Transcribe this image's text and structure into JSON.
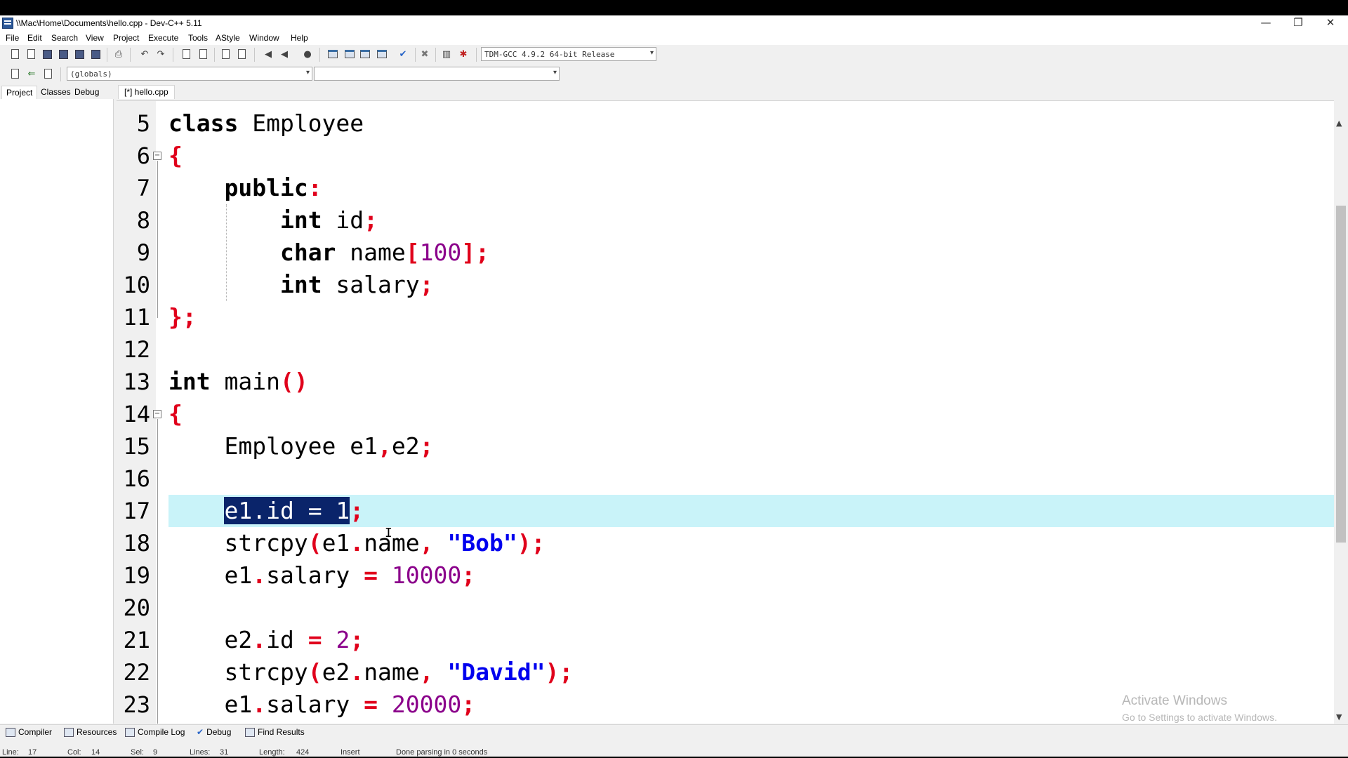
{
  "window": {
    "title": "\\\\Mac\\Home\\Documents\\hello.cpp - Dev-C++ 5.11",
    "minimize": "—",
    "restore": "❐",
    "close": "✕"
  },
  "menu": [
    "File",
    "Edit",
    "Search",
    "View",
    "Project",
    "Execute",
    "Tools",
    "AStyle",
    "Window",
    "Help"
  ],
  "toolbar": {
    "compiler_select": "TDM-GCC 4.9.2 64-bit Release",
    "scope_select": "(globals)",
    "member_select": ""
  },
  "left_tabs": [
    "Project",
    "Classes",
    "Debug"
  ],
  "file_tab": "[*] hello.cpp",
  "editor": {
    "current_line": 17,
    "lines": [
      {
        "num": "5",
        "tokens": [
          [
            "kw",
            "class"
          ],
          [
            "t",
            " Employee"
          ]
        ]
      },
      {
        "num": "6",
        "tokens": [
          [
            "p",
            "{"
          ]
        ]
      },
      {
        "num": "7",
        "tokens": [
          [
            "t",
            "    "
          ],
          [
            "kw",
            "public"
          ],
          [
            "p",
            ":"
          ]
        ]
      },
      {
        "num": "8",
        "tokens": [
          [
            "t",
            "        "
          ],
          [
            "kw",
            "int"
          ],
          [
            "t",
            " id"
          ],
          [
            "p",
            ";"
          ]
        ]
      },
      {
        "num": "9",
        "tokens": [
          [
            "t",
            "        "
          ],
          [
            "kw",
            "char"
          ],
          [
            "t",
            " name"
          ],
          [
            "p",
            "["
          ],
          [
            "n",
            "100"
          ],
          [
            "p",
            "];"
          ]
        ]
      },
      {
        "num": "10",
        "tokens": [
          [
            "t",
            "        "
          ],
          [
            "kw",
            "int"
          ],
          [
            "t",
            " salary"
          ],
          [
            "p",
            ";"
          ]
        ]
      },
      {
        "num": "11",
        "tokens": [
          [
            "p",
            "};"
          ]
        ]
      },
      {
        "num": "12",
        "tokens": []
      },
      {
        "num": "13",
        "tokens": [
          [
            "kw",
            "int"
          ],
          [
            "t",
            " main"
          ],
          [
            "p",
            "()"
          ]
        ]
      },
      {
        "num": "14",
        "tokens": [
          [
            "p",
            "{"
          ]
        ]
      },
      {
        "num": "15",
        "tokens": [
          [
            "t",
            "    Employee e1"
          ],
          [
            "p",
            ","
          ],
          [
            "t",
            "e2"
          ],
          [
            "p",
            ";"
          ]
        ]
      },
      {
        "num": "16",
        "tokens": []
      },
      {
        "num": "17",
        "tokens": [
          [
            "t",
            "    "
          ],
          [
            "sel",
            "e1.id = 1"
          ],
          [
            "p",
            ";"
          ]
        ]
      },
      {
        "num": "18",
        "tokens": [
          [
            "t",
            "    strcpy"
          ],
          [
            "p",
            "("
          ],
          [
            "t",
            "e1"
          ],
          [
            "p",
            "."
          ],
          [
            "t",
            "name"
          ],
          [
            "p",
            ","
          ],
          [
            "t",
            " "
          ],
          [
            "s",
            "\"Bob\""
          ],
          [
            "p",
            ");"
          ]
        ]
      },
      {
        "num": "19",
        "tokens": [
          [
            "t",
            "    e1"
          ],
          [
            "p",
            "."
          ],
          [
            "t",
            "salary "
          ],
          [
            "p",
            "="
          ],
          [
            "t",
            " "
          ],
          [
            "n",
            "10000"
          ],
          [
            "p",
            ";"
          ]
        ]
      },
      {
        "num": "20",
        "tokens": []
      },
      {
        "num": "21",
        "tokens": [
          [
            "t",
            "    e2"
          ],
          [
            "p",
            "."
          ],
          [
            "t",
            "id "
          ],
          [
            "p",
            "="
          ],
          [
            "t",
            " "
          ],
          [
            "n",
            "2"
          ],
          [
            "p",
            ";"
          ]
        ]
      },
      {
        "num": "22",
        "tokens": [
          [
            "t",
            "    strcpy"
          ],
          [
            "p",
            "("
          ],
          [
            "t",
            "e2"
          ],
          [
            "p",
            "."
          ],
          [
            "t",
            "name"
          ],
          [
            "p",
            ","
          ],
          [
            "t",
            " "
          ],
          [
            "s",
            "\"David\""
          ],
          [
            "p",
            ");"
          ]
        ]
      },
      {
        "num": "23",
        "tokens": [
          [
            "t",
            "    e1"
          ],
          [
            "p",
            "."
          ],
          [
            "t",
            "salary "
          ],
          [
            "p",
            "="
          ],
          [
            "t",
            " "
          ],
          [
            "n",
            "20000"
          ],
          [
            "p",
            ";"
          ]
        ]
      }
    ]
  },
  "watermark": {
    "line1": "Activate Windows",
    "line2": "Go to Settings to activate Windows."
  },
  "bottom_tabs": [
    "Compiler",
    "Resources",
    "Compile Log",
    "Debug",
    "Find Results"
  ],
  "status": {
    "line_label": "Line:",
    "line": "17",
    "col_label": "Col:",
    "col": "14",
    "sel_label": "Sel:",
    "sel": "9",
    "lines_label": "Lines:",
    "lines": "31",
    "length_label": "Length:",
    "length": "424",
    "mode": "Insert",
    "message": "Done parsing in 0 seconds"
  }
}
